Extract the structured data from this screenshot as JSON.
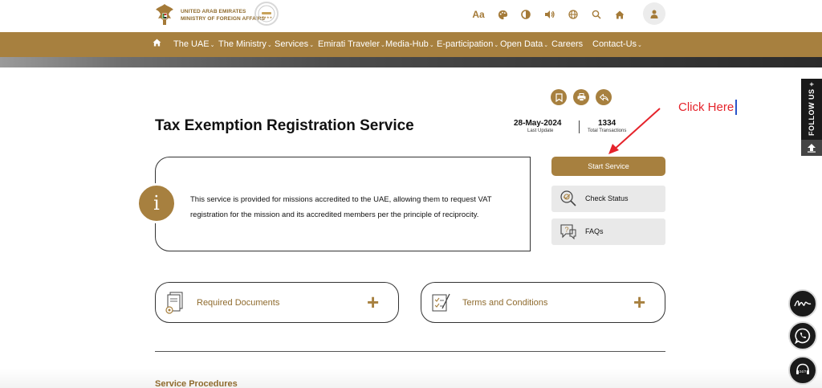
{
  "header": {
    "logo_line1": "UNITED ARAB EMIRATES",
    "logo_line2": "MINISTRY OF FOREIGN AFFAIRS",
    "tools": [
      "font-size-icon",
      "palette-icon",
      "contrast-icon",
      "speaker-icon",
      "globe-icon",
      "search-icon",
      "home-icon"
    ],
    "font_tool_label": "Aa"
  },
  "nav": {
    "items": [
      "The UAE",
      "The Ministry",
      "Services",
      "Emirati Traveler",
      "Media-Hub",
      "E-participation",
      "Open Data",
      "Careers",
      "Contact-Us"
    ],
    "caret": "⌄"
  },
  "service": {
    "title": "Tax Exemption Registration Service",
    "last_update_value": "28-May-2024",
    "last_update_label": "Last Update",
    "transactions_value": "1334",
    "transactions_label": "Total Transactions",
    "info_icon": "i",
    "description": "This service is provided for missions accredited to the UAE, allowing them to request VAT registration for the mission and its accredited members per the principle of reciprocity."
  },
  "annotation": {
    "text": "Click Here",
    "color": "#e5232b"
  },
  "actions": {
    "start": "Start Service",
    "check_status": "Check Status",
    "faqs": "FAQs"
  },
  "accordions": [
    {
      "label": "Required Documents",
      "toggle": "+"
    },
    {
      "label": "Terms and Conditions",
      "toggle": "+"
    }
  ],
  "section": {
    "procedures": "Service Procedures"
  },
  "follow": {
    "label": "FOLLOW US +"
  },
  "colors": {
    "brand": "#a7803f",
    "brand_text": "#8f6b2e",
    "nav_bg": "#a7803f"
  }
}
